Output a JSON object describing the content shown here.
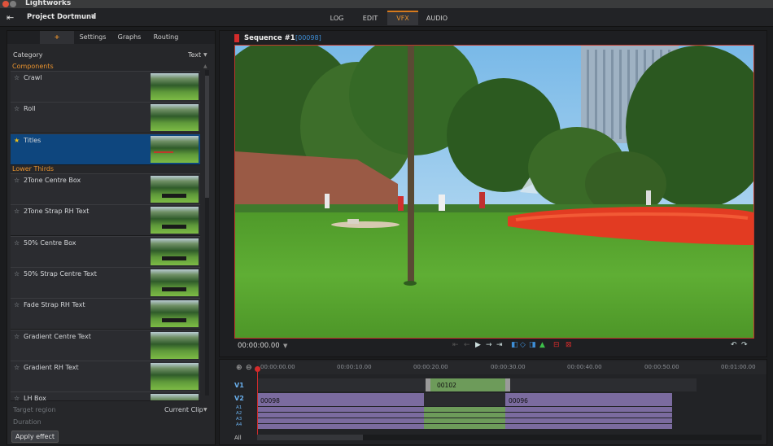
{
  "app": {
    "title": "Lightworks"
  },
  "menubar": {
    "project_name": "Project Dortmund",
    "tabs": [
      {
        "label": "LOG"
      },
      {
        "label": "EDIT"
      },
      {
        "label": "VFX"
      },
      {
        "label": "AUDIO"
      }
    ]
  },
  "effects_panel": {
    "subtabs": [
      {
        "label": "+"
      },
      {
        "label": "Settings"
      },
      {
        "label": "Graphs"
      },
      {
        "label": "Routing"
      }
    ],
    "category_label": "Category",
    "category_value": "Text",
    "groups": [
      {
        "label": "Components"
      },
      {
        "label": "Lower Thirds"
      }
    ],
    "items": [
      {
        "label": "Crawl"
      },
      {
        "label": "Roll"
      },
      {
        "label": "Titles"
      },
      {
        "label": "2Tone Centre Box"
      },
      {
        "label": "2Tone Strap RH Text"
      },
      {
        "label": "50% Centre Box"
      },
      {
        "label": "50% Strap Centre Text"
      },
      {
        "label": "Fade Strap RH Text"
      },
      {
        "label": "Gradient Centre Text"
      },
      {
        "label": "Gradient RH Text"
      },
      {
        "label": "LH Box"
      }
    ],
    "target_region_label": "Target region",
    "target_region_value": "Current Clip",
    "duration_label": "Duration",
    "apply_label": "Apply effect"
  },
  "viewer": {
    "sequence_title": "Sequence #1",
    "sequence_code": "[00098]",
    "timecode": "00:00:00.00"
  },
  "timeline": {
    "ruler": [
      "00:00:00.00",
      "00:00:10.00",
      "00:00:20.00",
      "00:00:30.00",
      "00:00:40.00",
      "00:00:50.00",
      "00:01:00.00"
    ],
    "tracks": {
      "v1": "V1",
      "v2": "V2",
      "a1": "A1",
      "a2": "A2",
      "a3": "A3",
      "a4": "A4",
      "all": "All"
    },
    "clips": {
      "v1_clip": "00102",
      "v2_clip_a": "00098",
      "v2_clip_b": "00096"
    }
  },
  "colors": {
    "accent_orange": "#e8922e",
    "selection_blue": "#0e467e",
    "playhead_red": "#d32b2b",
    "clip_purple": "#7b6b9f",
    "clip_green": "#6d9b5a"
  }
}
